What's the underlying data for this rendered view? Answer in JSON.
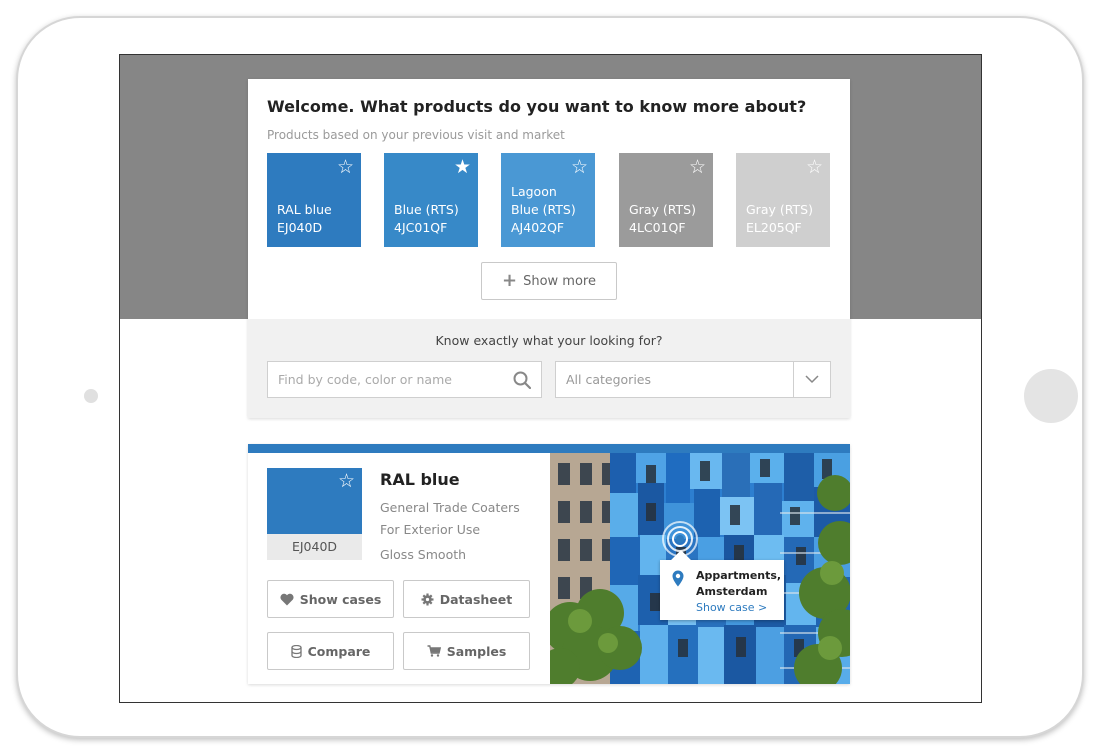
{
  "welcome": {
    "title": "Welcome. What products do you want to know more about?",
    "subtitle": "Products based on your previous visit and market",
    "show_more_label": "Show more",
    "swatches": [
      {
        "line1": "RAL blue",
        "line2": "EJ040D",
        "color": "#2e7bbf",
        "starred": false
      },
      {
        "line1": "Blue (RTS)",
        "line2": "4JC01QF",
        "color": "#3789c8",
        "starred": true
      },
      {
        "line1": "Lagoon Blue (RTS)",
        "line2": "AJ402QF",
        "color": "#4a98d4",
        "starred": false
      },
      {
        "line1": "Gray (RTS)",
        "line2": "4LC01QF",
        "color": "#9b9b9b",
        "starred": false
      },
      {
        "line1": "Gray (RTS)",
        "line2": "EL205QF",
        "color": "#cfcfcf",
        "starred": false
      }
    ]
  },
  "search": {
    "question": "Know exactly what your looking for?",
    "placeholder": "Find by code, color or name",
    "category_value": "All categories"
  },
  "product": {
    "name": "RAL blue",
    "code": "EJ040D",
    "details": [
      "General Trade Coaters",
      "For Exterior Use",
      "Gloss Smooth"
    ],
    "buttons": {
      "show_cases": "Show cases",
      "datasheet": "Datasheet",
      "compare": "Compare",
      "samples": "Samples"
    },
    "case": {
      "place": "Appartments, Amsterdam",
      "link": "Show case >"
    }
  },
  "icons": [
    "star-outline-icon",
    "star-filled-icon",
    "plus-icon",
    "search-icon",
    "chevron-down-icon",
    "heart-icon",
    "gear-icon",
    "database-icon",
    "cart-icon",
    "location-pin-icon"
  ],
  "colors": {
    "brand_blue": "#2e7bbf",
    "frame_gray": "#868686",
    "link_blue": "#2e7bbf"
  }
}
